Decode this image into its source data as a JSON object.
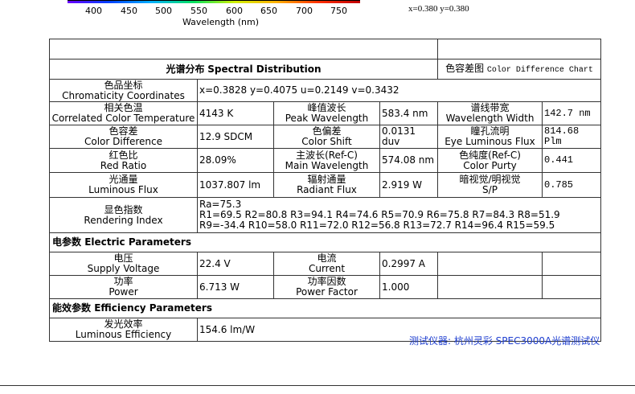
{
  "spectrum": {
    "ticks": [
      "400",
      "450",
      "500",
      "550",
      "600",
      "650",
      "700",
      "750"
    ],
    "xlabel": "Wavelength  (nm)",
    "xy_readout": "x=0.380  y=0.380"
  },
  "headers": {
    "spectral_cn": "光谱分布",
    "spectral_en": "Spectral Distribution",
    "chart_cn": "色容差图",
    "chart_en": "Color Difference Chart"
  },
  "rows": {
    "chromaticity": {
      "label_cn": "色品坐标",
      "label_en": "Chromaticity Coordinates",
      "value": "x=0.3828  y=0.4075  u=0.2149  v=0.3432"
    },
    "cct": {
      "label_cn": "相关色温",
      "label_en": "Correlated Color Temperature",
      "value": "4143  K"
    },
    "peak": {
      "label_cn": "峰值波长",
      "label_en": "Peak Wavelength",
      "value": "583.4 nm"
    },
    "spectrum_width": {
      "label_cn": "谱线带宽",
      "label_en": "Wavelength Width",
      "value": "142.7  nm"
    },
    "color_diff": {
      "label_cn": "色容差",
      "label_en": "Color Difference",
      "value": "12.9  SDCM"
    },
    "color_shift": {
      "label_cn": "色偏差",
      "label_en": "Color Shift",
      "value": "0.0131 duv"
    },
    "eye_flux": {
      "label_cn": "瞳孔流明",
      "label_en": "Eye Luminous Flux",
      "value": "814.68 Plm"
    },
    "red_ratio": {
      "label_cn": "红色比",
      "label_en": "Red Ratio",
      "value": "28.09%"
    },
    "main_wl": {
      "label_cn": "主波长(Ref-C)",
      "label_en": "Main Wavelength",
      "value": "574.08 nm"
    },
    "purity": {
      "label_cn": "色纯度(Ref-C)",
      "label_en": "Color Purty",
      "value": "0.441"
    },
    "flux": {
      "label_cn": "光通量",
      "label_en": "Luminous Flux",
      "value": "1037.807 lm"
    },
    "radiant": {
      "label_cn": "辐射通量",
      "label_en": "Radiant Flux",
      "value": "2.919  W"
    },
    "sp": {
      "label_cn": "暗视觉/明视觉",
      "label_en": "S/P",
      "value": "0.785"
    },
    "cri": {
      "label_cn": "显色指数",
      "label_en": "Rendering Index",
      "line1": "Ra=75.3",
      "line2": "R1=69.5  R2=80.8  R3=94.1  R4=74.6  R5=70.9  R6=75.8  R7=84.3  R8=51.9",
      "line3": "R9=-34.4  R10=58.0  R11=72.0  R12=56.8  R13=72.7  R14=96.4  R15=59.5"
    }
  },
  "electric": {
    "section_cn": "电参数",
    "section_en": "Electric Parameters",
    "voltage": {
      "label_cn": "电压",
      "label_en": "Supply Voltage",
      "value": "22.4  V"
    },
    "current": {
      "label_cn": "电流",
      "label_en": "Current",
      "value": "0.2997  A"
    },
    "power": {
      "label_cn": "功率",
      "label_en": "Power",
      "value": "6.713  W"
    },
    "pf": {
      "label_cn": "功率因数",
      "label_en": "Power Factor",
      "value": "1.000"
    }
  },
  "efficiency": {
    "section_cn": "能效参数",
    "section_en": "Efficiency Parameters",
    "eff": {
      "label_cn": "发光效率",
      "label_en": "Luminous Efficiency",
      "value": "154.6 lm/W"
    }
  },
  "footer": {
    "instrument": "测试仪器: 杭州灵彩  SPEC3000A光谱测试仪"
  },
  "colors": {
    "footer_text": "#1f3fd0",
    "border": "#333333"
  }
}
